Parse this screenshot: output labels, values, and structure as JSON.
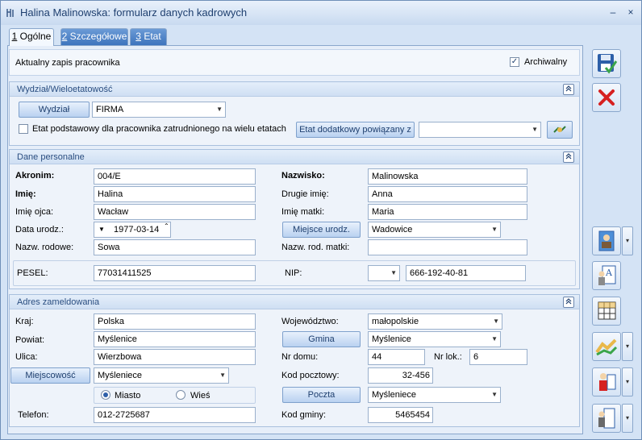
{
  "window": {
    "title": "Halina Malinowska: formularz danych kadrowych",
    "minimize": "–",
    "close": "×"
  },
  "tabs": [
    {
      "num": "1",
      "label": "Ogólne"
    },
    {
      "num": "2",
      "label": "Szczegółowe"
    },
    {
      "num": "3",
      "label": "Etat"
    }
  ],
  "top": {
    "record_label": "Aktualny zapis pracownika",
    "archived_label": "Archiwalny",
    "archived_mark": "✓"
  },
  "wydzial": {
    "title": "Wydział/Wieloetatowość",
    "button": "Wydział",
    "value": "FIRMA",
    "etat_checkbox_label": "Etat podstawowy dla pracownika zatrudnionego na wielu etatach",
    "etat_button": "Etat dodatkowy powiązany z",
    "etat_value": ""
  },
  "personal": {
    "title": "Dane personalne",
    "akronim_label": "Akronim:",
    "akronim": "004/E",
    "nazwisko_label": "Nazwisko:",
    "nazwisko": "Malinowska",
    "imie_label": "Imię:",
    "imie": "Halina",
    "drugie_label": "Drugie imię:",
    "drugie": "Anna",
    "ojca_label": "Imię ojca:",
    "ojca": "Wacław",
    "matki_label": "Imię matki:",
    "matki": "Maria",
    "data_label": "Data urodz.:",
    "data": "1977-03-14",
    "miejsce_button": "Miejsce urodz.",
    "miejsce": "Wadowice",
    "rodowe_label": "Nazw. rodowe:",
    "rodowe": "Sowa",
    "rod_matki_label": "Nazw. rod. matki:",
    "rod_matki": "",
    "pesel_label": "PESEL:",
    "pesel": "77031411525",
    "nip_label": "NIP:",
    "nip_prefix": "",
    "nip": "666-192-40-81"
  },
  "address": {
    "title": "Adres zameldowania",
    "kraj_label": "Kraj:",
    "kraj": "Polska",
    "woj_label": "Województwo:",
    "woj": "małopolskie",
    "powiat_label": "Powiat:",
    "powiat": "Myślenice",
    "gmina_button": "Gmina",
    "gmina": "Myślenice",
    "ulica_label": "Ulica:",
    "ulica": "Wierzbowa",
    "nrdomu_label": "Nr domu:",
    "nrdomu": "44",
    "nrlok_label": "Nr lok.:",
    "nrlok": "6",
    "miejscowosc_button": "Miejscowość",
    "miejscowosc": "Myśleniece",
    "kod_label": "Kod pocztowy:",
    "kod": "32-456",
    "miasto_label": "Miasto",
    "wies_label": "Wieś",
    "poczta_button": "Poczta",
    "poczta": "Myśleniece",
    "telefon_label": "Telefon:",
    "telefon": "012-2725687",
    "kodgminy_label": "Kod gminy:",
    "kodgminy": "5465454"
  },
  "side": {
    "dropdown_arrow": "▼",
    "dd_arrow": "▾",
    "up_down": "⌃⌄"
  },
  "colors": {
    "accent": "#2d5fa8",
    "save_green": "#3aa54a",
    "cancel_red": "#d62020"
  }
}
